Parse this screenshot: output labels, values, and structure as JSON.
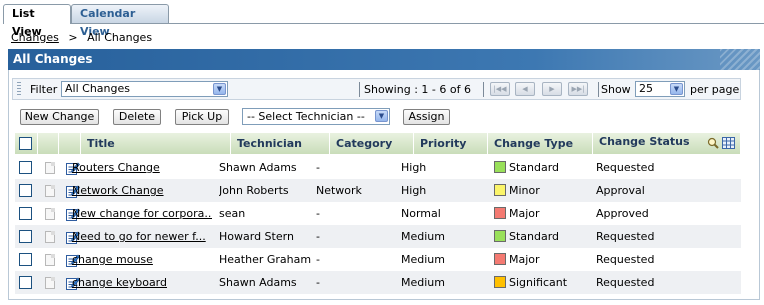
{
  "tabs": [
    {
      "label": "List View",
      "active": true
    },
    {
      "label": "Calendar View",
      "active": false
    }
  ],
  "breadcrumb": {
    "link": "Changes",
    "separator": ">",
    "current": "All Changes"
  },
  "panel_title": "All Changes",
  "filter": {
    "label": "Filter",
    "selected": "All Changes",
    "showing": "Showing : 1 - 6 of 6",
    "show_label": "Show",
    "page_size": "25",
    "per_page_label": "per page"
  },
  "toolbar": {
    "new_change": "New Change",
    "delete": "Delete",
    "pick_up": "Pick Up",
    "technician_select": "-- Select Technician --",
    "assign": "Assign"
  },
  "columns": [
    "Title",
    "Technician",
    "Category",
    "Priority",
    "Change Type",
    "Change Status"
  ],
  "colors": {
    "Standard": "#99e05a",
    "Minor": "#fbf56a",
    "Major": "#f47a72",
    "Significant": "#ffc000",
    "title_bar": "#2f68a3",
    "header_bg": "#d6e6c8"
  },
  "rows": [
    {
      "title": "Routers Change",
      "technician": "Shawn Adams",
      "category": "-",
      "priority": "High",
      "change_type": "Standard",
      "status": "Requested"
    },
    {
      "title": "Network Change",
      "technician": "John Roberts",
      "category": "Network",
      "priority": "High",
      "change_type": "Minor",
      "status": "Approval"
    },
    {
      "title": "New change for corpora...",
      "technician": "sean",
      "category": "-",
      "priority": "Normal",
      "change_type": "Major",
      "status": "Approved"
    },
    {
      "title": "Need to go for newer f...",
      "technician": "Howard Stern",
      "category": "-",
      "priority": "Medium",
      "change_type": "Standard",
      "status": "Requested"
    },
    {
      "title": "change mouse",
      "technician": "Heather Graham",
      "category": "-",
      "priority": "Medium",
      "change_type": "Major",
      "status": "Requested"
    },
    {
      "title": "change keyboard",
      "technician": "Shawn Adams",
      "category": "-",
      "priority": "Medium",
      "change_type": "Significant",
      "status": "Requested"
    }
  ]
}
